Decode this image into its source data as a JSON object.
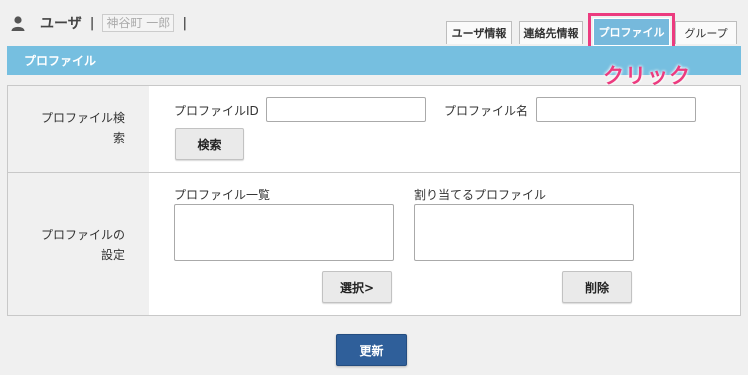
{
  "header": {
    "user_label": "ユーザ",
    "separator": "|",
    "user_name": "神谷町 一郎",
    "separator_end": "|"
  },
  "tabs": [
    {
      "label": "ユーザ情報"
    },
    {
      "label": "連絡先情報"
    },
    {
      "label": "プロファイル"
    },
    {
      "label": "グループ"
    }
  ],
  "active_tab": "プロファイル",
  "section_title": "プロファイル",
  "annotation": "クリック",
  "search_row": {
    "label": "プロファイル検索",
    "id_label": "プロファイルID",
    "id_value": "",
    "name_label": "プロファイル名",
    "name_value": "",
    "search_button": "検索"
  },
  "settings_row": {
    "label": "プロファイルの設定",
    "list_label": "プロファイル一覧",
    "assigned_label": "割り当てるプロファイル",
    "select_button": "選択>",
    "delete_button": "削除"
  },
  "update_button": "更新",
  "colors": {
    "header_bar": "#76bfe0",
    "highlight": "#ec3b7f",
    "update_button": "#2f5f9a"
  }
}
